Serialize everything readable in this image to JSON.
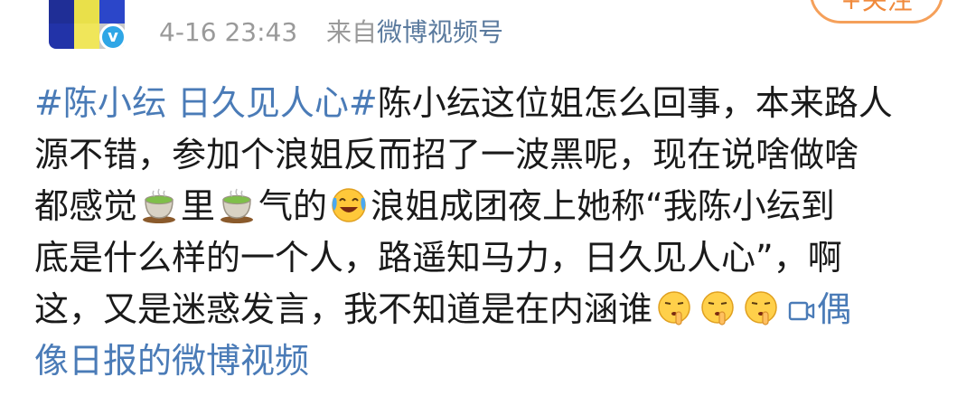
{
  "header": {
    "time": "4-16 23:43",
    "source_prefix": "来自",
    "source_name": "微博视频号",
    "follow_label": "+关注"
  },
  "post": {
    "line1": {
      "hashtag": "#陈小纭 日久见人心#",
      "text": "陈小纭这位姐怎么回事，本来路人"
    },
    "line2": "源不错，参加个浪姐反而招了一波黑呢，现在说啥做啥",
    "line3": {
      "a": "都感觉",
      "b": "里",
      "c": "气的",
      "d": "浪姐成团夜上她称“我陈小纭到"
    },
    "line4": "底是什么样的一个人，路遥知马力，日久见人心”，啊",
    "line5": {
      "text": "这，又是迷惑发言，我不知道是在内涵谁",
      "link_part1": "偶"
    },
    "line6": {
      "link_part2": "像日报的微博视频"
    }
  },
  "icons": {
    "tea": "tea-emoji-icon",
    "laugh": "laugh-cry-emoji-icon",
    "shush": "shush-emoji-icon",
    "video": "video-icon"
  },
  "colors": {
    "link": "#4a7bb7",
    "text": "#1a1a1a",
    "meta": "#9a9a9a",
    "follow": "#f08a3c"
  }
}
